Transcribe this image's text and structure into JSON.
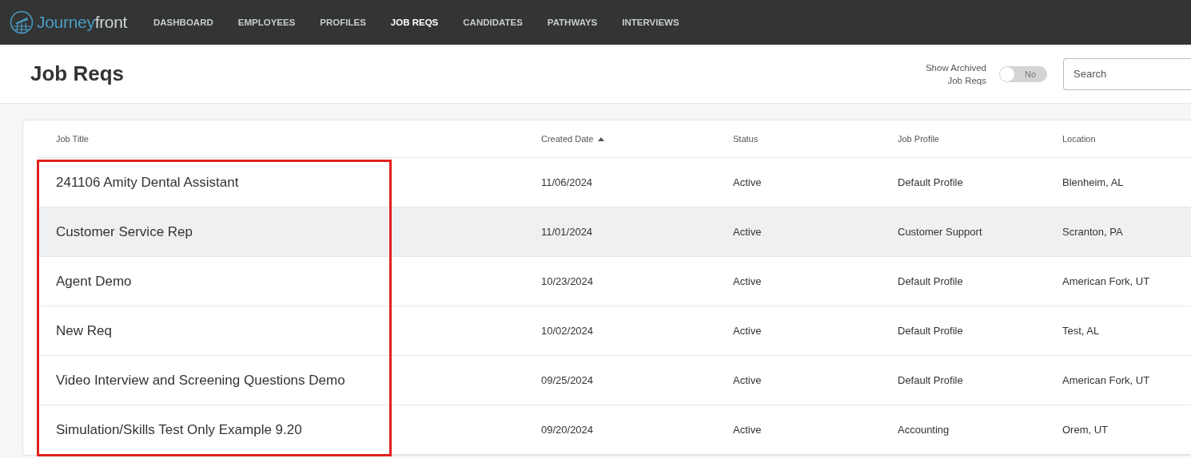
{
  "nav": {
    "brand": {
      "first": "Journey",
      "second": "front"
    },
    "items": [
      {
        "label": "DASHBOARD",
        "selected": false
      },
      {
        "label": "EMPLOYEES",
        "selected": false
      },
      {
        "label": "PROFILES",
        "selected": false
      },
      {
        "label": "JOB REQS",
        "selected": true
      },
      {
        "label": "CANDIDATES",
        "selected": false
      },
      {
        "label": "PATHWAYS",
        "selected": false
      },
      {
        "label": "INTERVIEWS",
        "selected": false
      }
    ]
  },
  "page": {
    "title": "Job Reqs",
    "archived_toggle": {
      "label": "Show Archived Job Reqs",
      "state_text": "No",
      "on": false
    },
    "search": {
      "placeholder": "Search"
    }
  },
  "table": {
    "columns": [
      {
        "label": "Job Title",
        "sorted": false
      },
      {
        "label": "Created Date",
        "sorted": true
      },
      {
        "label": "Status",
        "sorted": false
      },
      {
        "label": "Job Profile",
        "sorted": false
      },
      {
        "label": "Location",
        "sorted": false
      }
    ],
    "rows": [
      {
        "cells": [
          "241106 Amity Dental Assistant",
          "11/06/2024",
          "Active",
          "Default Profile",
          "Blenheim, AL"
        ],
        "highlighted": false
      },
      {
        "cells": [
          "Customer Service Rep",
          "11/01/2024",
          "Active",
          "Customer Support",
          "Scranton, PA"
        ],
        "highlighted": true
      },
      {
        "cells": [
          "Agent Demo",
          "10/23/2024",
          "Active",
          "Default Profile",
          "American Fork, UT"
        ],
        "highlighted": false
      },
      {
        "cells": [
          "New Req",
          "10/02/2024",
          "Active",
          "Default Profile",
          "Test, AL"
        ],
        "highlighted": false
      },
      {
        "cells": [
          "Video Interview and Screening Questions Demo",
          "09/25/2024",
          "Active",
          "Default Profile",
          "American Fork, UT"
        ],
        "highlighted": false
      },
      {
        "cells": [
          "Simulation/Skills Test Only Example 9.20",
          "09/20/2024",
          "Active",
          "Accounting",
          "Orem, UT"
        ],
        "highlighted": false
      }
    ]
  }
}
